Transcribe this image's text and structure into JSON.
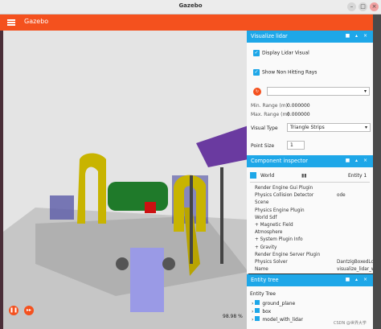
{
  "window": {
    "title": "Gazebo"
  },
  "appbar": {
    "name": "Gazebo"
  },
  "viewport": {
    "zoom": "98.98 %"
  },
  "lidar_panel": {
    "title": "Visualize lidar",
    "display_label": "Display Lidar Visual",
    "non_hitting_label": "Show Non Hitting Rays",
    "min_range_label": "Min. Range (m)",
    "min_range_value": "0.000000",
    "max_range_label": "Max. Range (m)",
    "max_range_value": "0.000000",
    "visual_type_label": "Visual Type",
    "visual_type_value": "Triangle Strips",
    "point_size_label": "Point Size",
    "point_size_value": "1"
  },
  "component_panel": {
    "title": "Component inspector",
    "entity_name": "World",
    "entity_id": "Entity 1",
    "rows": [
      {
        "label": "Render Engine Gui Plugin",
        "value": ""
      },
      {
        "label": "Physics Collision Detector",
        "value": "ode"
      },
      {
        "label": "Scene",
        "value": ""
      },
      {
        "label": "Physics Engine Plugin",
        "value": ""
      },
      {
        "label": "World Sdf",
        "value": ""
      },
      {
        "label": "+ Magnetic Field",
        "value": ""
      },
      {
        "label": "Atmosphere",
        "value": ""
      },
      {
        "label": "+ System Plugin Info",
        "value": ""
      },
      {
        "label": "+ Gravity",
        "value": ""
      },
      {
        "label": "Render Engine Server Plugin",
        "value": ""
      },
      {
        "label": "Physics Solver",
        "value": "DantzigBoxedLcpSolver"
      },
      {
        "label": "Name",
        "value": "visualize_lidar_world"
      }
    ]
  },
  "entity_panel": {
    "title": "Entity tree",
    "header": "Entity Tree",
    "items": [
      "ground_plane",
      "box",
      "model_with_lidar"
    ]
  },
  "watermark": "CSDN @世界大学",
  "colors": {
    "accent": "#f4511e",
    "panel_header": "#1ea7e8"
  }
}
